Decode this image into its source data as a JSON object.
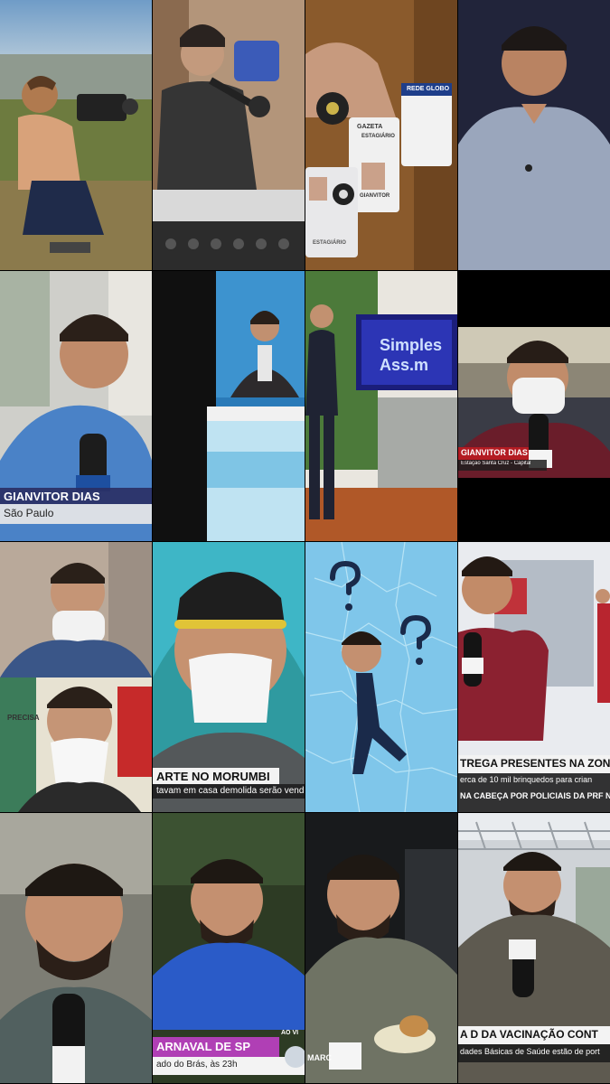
{
  "collage": {
    "badges": {
      "rede_globo": "REDE GLOBO",
      "estagiario": "ESTAGIÁRIO",
      "gazeta": "GAZETA",
      "gianvitor": "GIANVITOR"
    },
    "tiles": {
      "r2c1_name": "GIANVITOR DIAS",
      "r2c1_place": "São Paulo",
      "r2c3_sign_line1": "Simples",
      "r2c3_sign_line2": "Ass.m",
      "r2c4_name": "GIANVITOR DIAS",
      "r2c4_place": "Estação Santa Cruz - Capital",
      "r3c1_sign": "PRECISA",
      "r3c2_headline": "ARTE NO MORUMBI",
      "r3c2_sub": "tavam em casa demolida serão vendi",
      "r3c4_headline": "TREGA PRESENTES NA ZONA",
      "r3c4_sub1": "erca de 10 mil brinquedos para crian",
      "r3c4_sub2": "NA CABEÇA POR POLICIAIS DA PRF NO",
      "r4c2_headline": "ARNAVAL DE SP",
      "r4c2_sub": "ado do Brás, às 23h",
      "r4c2_live": "AO VI",
      "r4c3_brand": "MARC",
      "r4c4_headline": "A D DA VACINAÇÃO CONT",
      "r4c4_sub": "dades Básicas de Saúde estão de port"
    }
  }
}
